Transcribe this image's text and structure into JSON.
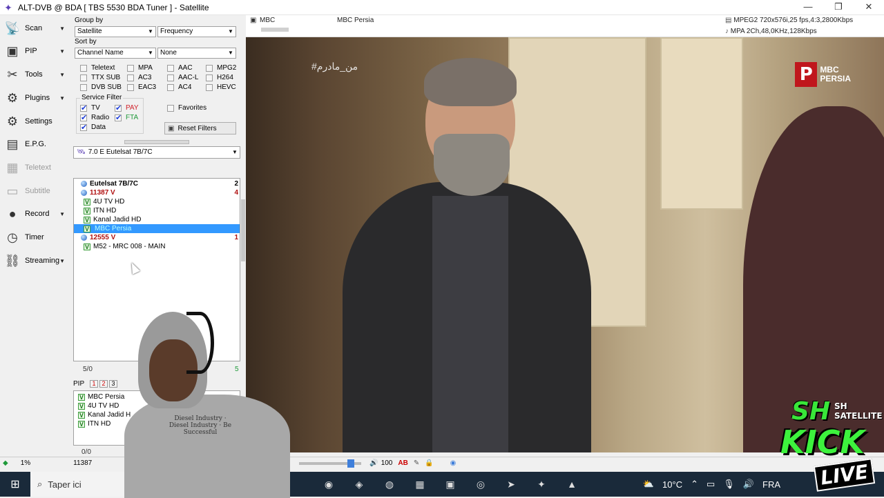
{
  "window": {
    "title": "ALT-DVB @ BDA [ TBS 5530 BDA Tuner ] - Satellite",
    "buttons": [
      "—",
      "❐",
      "✕"
    ]
  },
  "leftnav": [
    {
      "label": "Scan",
      "icon": "satellite-dish-icon",
      "arrow": true,
      "disabled": false
    },
    {
      "label": "PIP",
      "icon": "pip-icon",
      "arrow": true,
      "disabled": false
    },
    {
      "label": "Tools",
      "icon": "tools-icon",
      "arrow": true,
      "disabled": false
    },
    {
      "label": "Plugins",
      "icon": "plugins-icon",
      "arrow": true,
      "disabled": false
    },
    {
      "label": "Settings",
      "icon": "gear-icon",
      "arrow": false,
      "disabled": false
    },
    {
      "label": "E.P.G.",
      "icon": "epg-icon",
      "arrow": false,
      "disabled": false
    },
    {
      "label": "Teletext",
      "icon": "teletext-icon",
      "arrow": false,
      "disabled": true
    },
    {
      "label": "Subtitle",
      "icon": "subtitle-icon",
      "arrow": false,
      "disabled": true
    },
    {
      "label": "Record",
      "icon": "record-icon",
      "arrow": true,
      "disabled": false
    },
    {
      "label": "Timer",
      "icon": "clock-icon",
      "arrow": false,
      "disabled": false
    },
    {
      "label": "Streaming",
      "icon": "network-icon",
      "arrow": true,
      "disabled": false
    }
  ],
  "filters": {
    "group_by_label": "Group by",
    "group_by": "Satellite",
    "group_by2": "Frequency",
    "sort_by_label": "Sort by",
    "sort_by": "Channel Name",
    "sort_by2": "None",
    "checks": [
      "Teletext",
      "MPA",
      "AAC",
      "MPG2",
      "TTX SUB",
      "AC3",
      "AAC-L",
      "H264",
      "DVB SUB",
      "EAC3",
      "AC4",
      "HEVC"
    ],
    "service_filter_label": "Service Filter",
    "service": [
      {
        "label": "TV",
        "on": true,
        "color": "#000"
      },
      {
        "label": "PAY",
        "on": true,
        "color": "#d0202a"
      },
      {
        "label": "Radio",
        "on": true,
        "color": "#000"
      },
      {
        "label": "FTA",
        "on": true,
        "color": "#1f9a3a"
      },
      {
        "label": "Data",
        "on": true,
        "color": "#000"
      }
    ],
    "favorites": "Favorites",
    "reset": "Reset Filters",
    "satellite": "7.0 E Eutelsat 7B/7C"
  },
  "tree": [
    {
      "type": "sat",
      "label": "Eutelsat 7B/7C",
      "count": "2"
    },
    {
      "type": "tp",
      "label": "11387 V",
      "count": "4"
    },
    {
      "type": "ch",
      "label": "4U TV HD"
    },
    {
      "type": "ch",
      "label": "ITN HD"
    },
    {
      "type": "ch",
      "label": "Kanal Jadid HD"
    },
    {
      "type": "ch",
      "label": "MBC Persia",
      "selected": true
    },
    {
      "type": "tp",
      "label": "12555 V",
      "count": "1"
    },
    {
      "type": "ch",
      "label": "M52 - MRC 008 - MAIN"
    }
  ],
  "tree_status": {
    "left": "5/0",
    "right": "5"
  },
  "pip": {
    "label": "PIP",
    "tabs": [
      "1",
      "2",
      "3"
    ],
    "items": [
      "MBC Persia",
      "4U TV HD",
      "Kanal Jadid H",
      "ITN HD"
    ],
    "status": "0/0"
  },
  "video_header": {
    "channel_short": "MBC",
    "channel": "MBC Persia",
    "video_info": "MPEG2 720x576i,25 fps,4:3,2800Kbps",
    "audio_info": "MPA 2Ch,48,0KHz,128Kbps"
  },
  "video_overlay": {
    "hashtag": "#من_مادرم",
    "logo_top": "MBC",
    "logo_bottom": "PERSIA"
  },
  "bottombar": {
    "percent": "1%",
    "freq": "11387",
    "volume": "100"
  },
  "taskbar": {
    "search_placeholder": "Taper ici",
    "temp": "10°C",
    "lang": "FRA"
  },
  "overlay_brand": {
    "top": "SH",
    "sat": "SH SATELLITE",
    "kick": "KICK",
    "live": "LIVE"
  },
  "hoodie_print": "Diesel Industry · Diesel Industry · Be Successful"
}
